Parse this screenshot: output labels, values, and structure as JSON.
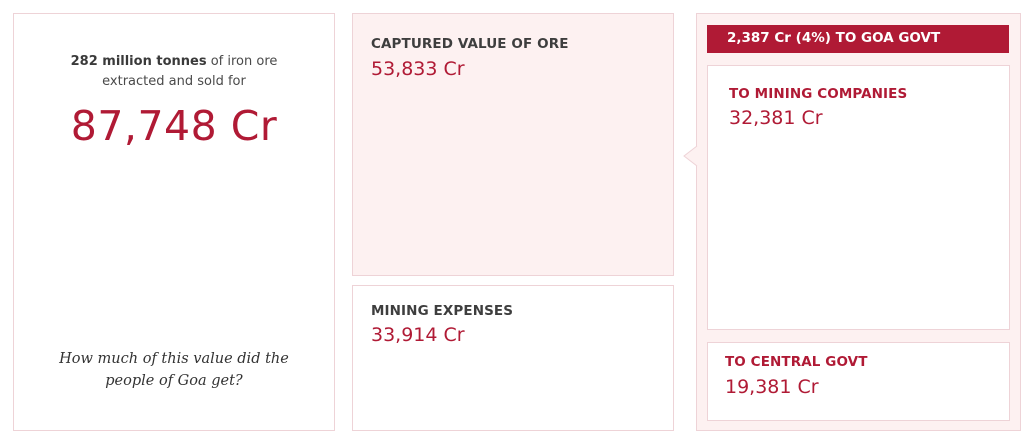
{
  "total": {
    "intro_bold": "282 million tonnes",
    "intro_rest": "of iron ore",
    "intro_line2": "extracted and sold for",
    "value": "87,748 Cr",
    "question_line1": "How much of this value did the",
    "question_line2": "people of Goa get?"
  },
  "captured": {
    "label": "CAPTURED VALUE OF ORE",
    "value": "53,833 Cr"
  },
  "expenses": {
    "label": "MINING EXPENSES",
    "value": "33,914 Cr"
  },
  "breakdown": {
    "goa_govt": "2,387 Cr (4%) TO GOA GOVT",
    "companies_label": "TO MINING COMPANIES",
    "companies_value": "32,381 Cr",
    "central_label": "TO CENTRAL GOVT",
    "central_value": "19,381 Cr"
  },
  "colors": {
    "accent": "#b01a35",
    "panel_tint": "#fdf1f1",
    "border": "#eed3d7",
    "text_dark": "#3e3e3e"
  }
}
